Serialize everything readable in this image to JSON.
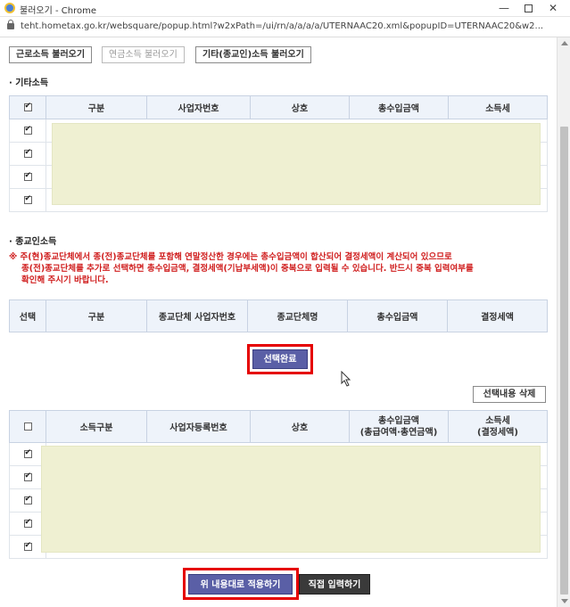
{
  "window": {
    "title": "불러오기 - Chrome",
    "url": "teht.hometax.go.kr/websquare/popup.html?w2xPath=/ui/rn/a/a/a/a/UTERNAAC20.xml&popupID=UTERNAAC20&w2...",
    "min_glyph": "—",
    "close_glyph": "✕"
  },
  "top_buttons": {
    "earned": "근로소득 불러오기",
    "pension": "연금소득 불러오기",
    "other": "기타(종교인)소득 불러오기"
  },
  "other_income": {
    "title": "기타소득",
    "headers": [
      "구분",
      "사업자번호",
      "상호",
      "총수입금액",
      "소득세"
    ],
    "rows_checked": [
      true,
      true,
      true,
      true
    ]
  },
  "religious_income": {
    "title": "종교인소득",
    "notice_lines": [
      "※ 주(현)종교단체에서 종(전)종교단체를 포함해 연말정산한 경우에는 총수입금액이 합산되어 결정세액이 계산되어 있으므로",
      "종(전)종교단체를 추가로 선택하면 총수입금액, 결정세액(기납부세액)이 중복으로 입력될 수 있습니다. 반드시 중복 입력여부를",
      "확인해 주시기 바랍니다."
    ],
    "headers": [
      "선택",
      "구분",
      "종교단체 사업자번호",
      "종교단체명",
      "총수입금액",
      "결정세액"
    ],
    "select_done_label": "선택완료"
  },
  "selection": {
    "delete_label": "선택내용 삭제",
    "headers": [
      "소득구분",
      "사업자등록번호",
      "상호",
      "총수입금액\n(총급여액·총연금액)",
      "소득세\n(결정세액)"
    ],
    "rows_checked": [
      true,
      true,
      true,
      true,
      true
    ]
  },
  "footer": {
    "apply_label": "위 내용대로 적용하기",
    "direct_label": "직접 입력하기"
  },
  "colors": {
    "primary_button": "#5a5fa6",
    "dark_button": "#3a3a3a",
    "highlight": "#e50000",
    "notice_text": "#d02020",
    "header_bg": "#eef3fa",
    "redacted_bg": "#eff0d2"
  }
}
